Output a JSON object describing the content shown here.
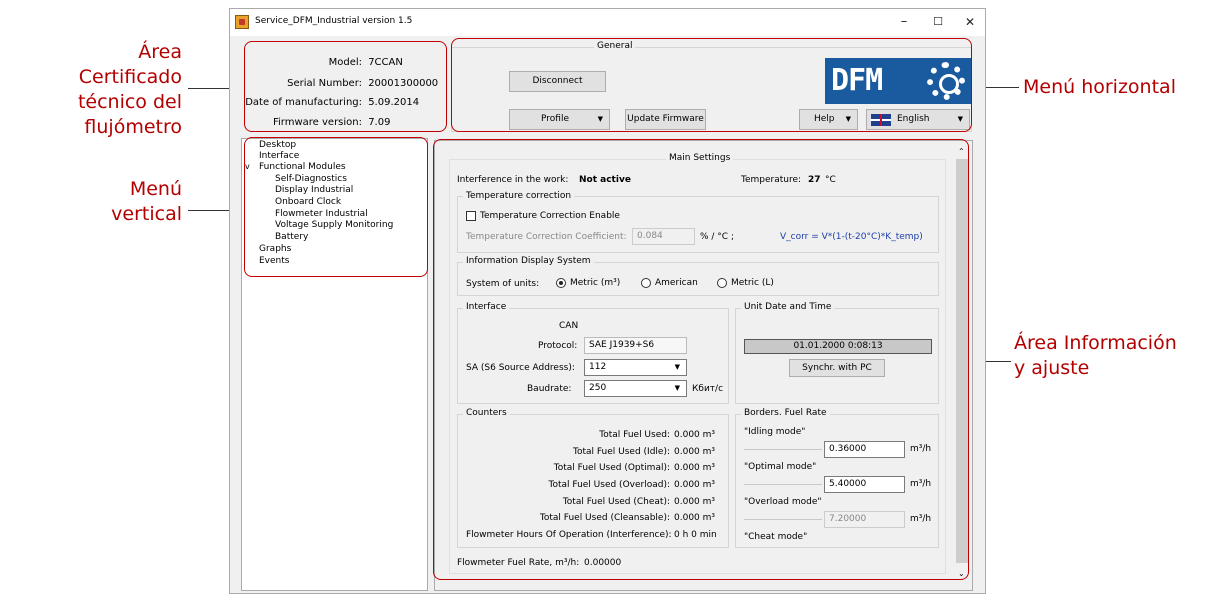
{
  "annotations": {
    "cert_area": [
      "Área Certificado",
      "técnico del",
      "flujómetro"
    ],
    "vertical_menu": [
      "Menú",
      "vertical"
    ],
    "horizontal_menu": "Menú horizontal",
    "info_area": [
      "Área Información",
      "y ajuste"
    ]
  },
  "window": {
    "title": "Service_DFM_Industrial version 1.5",
    "minimize": "–",
    "maximize": "☐",
    "close": "✕"
  },
  "certificate": {
    "model_label": "Model:",
    "model": "7CCAN",
    "serial_label": "Serial Number:",
    "serial": "20001300000",
    "date_label": "Date of manufacturing:",
    "date": "5.09.2014",
    "firmware_label": "Firmware version:",
    "firmware": "7.09"
  },
  "general": {
    "title": "General",
    "disconnect": "Disconnect",
    "profile": "Profile",
    "update_firmware": "Update Firmware",
    "help": "Help",
    "language": "English",
    "logo_text": "DFM"
  },
  "tree": {
    "items": [
      "Desktop",
      "Interface",
      "Functional Modules",
      "Self-Diagnostics",
      "Display Industrial",
      "Onboard Clock",
      "Flowmeter Industrial",
      "Voltage Supply Monitoring",
      "Battery",
      "Graphs",
      "Events"
    ],
    "expander": "v"
  },
  "main": {
    "title": "Main Settings",
    "interference_label": "Interference in the work:",
    "interference_value": "Not active",
    "temperature_label": "Temperature:",
    "temperature_value": "27",
    "temperature_unit": "°C",
    "temp_correction": {
      "title": "Temperature correction",
      "enable_label": "Temperature Correction Enable",
      "enabled": false,
      "coef_label": "Temperature Correction Coefficient:",
      "coef_value": "0.084",
      "coef_unit": "% / °C ;",
      "formula": "V_corr = V*(1-(t-20°C)*K_temp)",
      "formula_color": "#1c3fa8"
    },
    "info_display": {
      "title": "Information Display System",
      "units_label": "System of units:",
      "options": [
        "Metric (m³)",
        "American",
        "Metric (L)"
      ],
      "selected": "Metric (m³)"
    },
    "interface": {
      "title": "Interface",
      "bus": "CAN",
      "protocol_label": "Protocol:",
      "protocol": "SAE J1939+S6",
      "sa_label": "SA (S6 Source Address):",
      "sa": "112",
      "baud_label": "Baudrate:",
      "baud": "250",
      "baud_unit": "Кбит/с"
    },
    "datetime": {
      "title": "Unit Date and Time",
      "value": "01.01.2000 0:08:13",
      "sync": "Synchr. with PC"
    },
    "counters": {
      "title": "Counters",
      "rows": [
        {
          "label": "Total Fuel Used:",
          "value": "0.000 m³"
        },
        {
          "label": "Total Fuel Used (Idle):",
          "value": "0.000 m³"
        },
        {
          "label": "Total Fuel Used (Optimal):",
          "value": "0.000 m³"
        },
        {
          "label": "Total Fuel Used (Overload):",
          "value": "0.000 m³"
        },
        {
          "label": "Total Fuel Used (Cheat):",
          "value": "0.000 m³"
        },
        {
          "label": "Total Fuel Used (Cleansable):",
          "value": "0.000 m³"
        },
        {
          "label": "Flowmeter Hours Of Operation (Interference):",
          "value": "0 h 0 min"
        }
      ]
    },
    "borders": {
      "title": "Borders. Fuel Rate",
      "idling": "\"Idling mode\"",
      "optimal": "\"Optimal mode\"",
      "overload": "\"Overload mode\"",
      "cheat": "\"Cheat mode\"",
      "v1": "0.36000",
      "v2": "5.40000",
      "v3": "7.20000",
      "unit": "m³/h"
    },
    "fuel_rate_label": "Flowmeter Fuel Rate, m³/h:",
    "fuel_rate_value": "0.00000"
  },
  "colors": {
    "highlight": "#c00000",
    "logo_bg": "#1a5a9e"
  }
}
